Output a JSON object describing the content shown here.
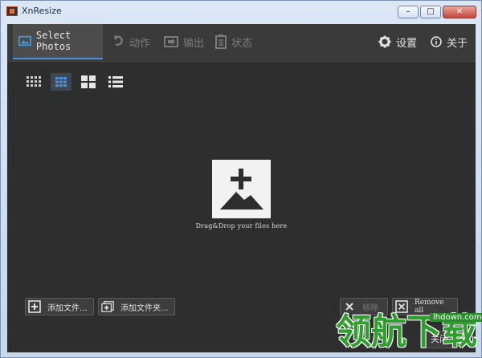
{
  "window": {
    "title": "XnResize"
  },
  "topbar": {
    "tabs": [
      {
        "label": "Select Photos",
        "icon": "photos-icon",
        "active": true
      },
      {
        "label": "动作",
        "icon": "action-icon"
      },
      {
        "label": "输出",
        "icon": "output-icon"
      },
      {
        "label": "状态",
        "icon": "status-icon"
      }
    ],
    "settings_label": "设置",
    "about_label": "关于"
  },
  "view_modes": [
    "small-grid",
    "medium-grid",
    "large-grid",
    "list"
  ],
  "drop_zone": {
    "text": "Drag&Drop your files here"
  },
  "buttons": {
    "add_files": "添加文件...",
    "add_folder": "添加文件夹...",
    "remove": "移除",
    "remove_all": "Remove all",
    "close": "关闭"
  },
  "watermark": {
    "site": "lhdown.com",
    "big": "领航下载"
  },
  "colors": {
    "accent": "#4a93d8",
    "background": "#2e2e2e",
    "topbar": "#3a3a3a"
  }
}
